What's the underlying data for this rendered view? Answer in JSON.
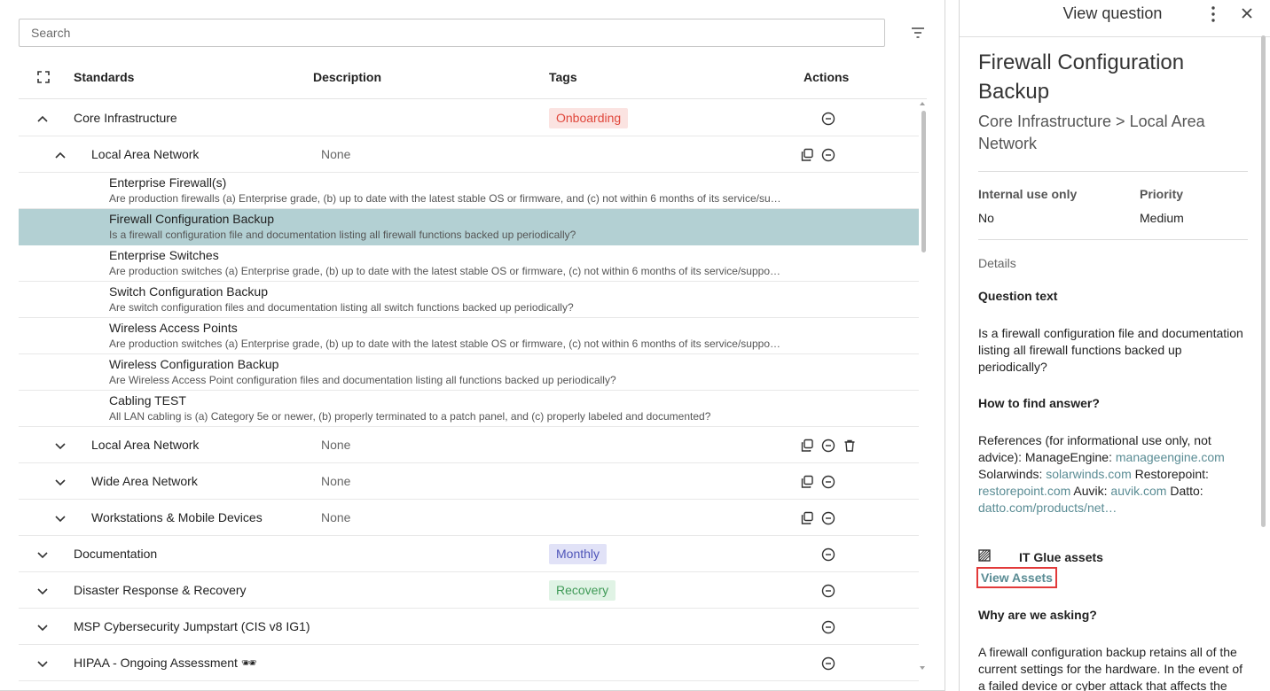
{
  "search": {
    "placeholder": "Search"
  },
  "table": {
    "headers": {
      "standards": "Standards",
      "description": "Description",
      "tags": "Tags",
      "actions": "Actions"
    },
    "groups": {
      "core": {
        "name": "Core Infrastructure",
        "tag": "Onboarding"
      },
      "lan1": {
        "name": "Local Area Network",
        "desc": "None"
      },
      "lan2": {
        "name": "Local Area Network",
        "desc": "None"
      },
      "wan": {
        "name": "Wide Area Network",
        "desc": "None"
      },
      "work": {
        "name": "Workstations & Mobile Devices",
        "desc": "None"
      },
      "doc": {
        "name": "Documentation",
        "tag": "Monthly"
      },
      "drr": {
        "name": "Disaster Response & Recovery",
        "tag": "Recovery"
      },
      "msp": {
        "name": "MSP Cybersecurity Jumpstart (CIS v8 IG1)"
      },
      "hipaa": {
        "name": "HIPAA - Ongoing Assessment 🕶"
      }
    },
    "questions": [
      {
        "title": "Enterprise Firewall(s)",
        "subtitle": "Are production firewalls (a) Enterprise grade, (b) up to date with the latest stable OS or firmware, and (c) not within 6 months of its service/support end-of-life date?"
      },
      {
        "title": "Firewall Configuration Backup",
        "subtitle": "Is a firewall configuration file and documentation listing all firewall functions backed up periodically?"
      },
      {
        "title": "Enterprise Switches",
        "subtitle": "Are production switches (a) Enterprise grade, (b) up to date with the latest stable OS or firmware, (c) not within 6 months of its service/support end-of-life date?"
      },
      {
        "title": "Switch Configuration Backup",
        "subtitle": "Are switch configuration files and documentation listing all switch functions backed up periodically?"
      },
      {
        "title": "Wireless Access Points",
        "subtitle": "Are production switches (a) Enterprise grade, (b) up to date with the latest stable OS or firmware, (c) not within 6 months of its service/support end-of-life date?"
      },
      {
        "title": "Wireless Configuration Backup",
        "subtitle": "Are Wireless Access Point configuration files and documentation listing all functions backed up periodically?"
      },
      {
        "title": "Cabling TEST",
        "subtitle": "All LAN cabling is (a) Category 5e or newer, (b) properly terminated to a patch panel, and (c) properly labeled and documented?"
      }
    ]
  },
  "detail": {
    "header_title": "View question",
    "title": "Firewall Configuration Backup",
    "path": "Core Infrastructure > Local Area Network",
    "internal_label": "Internal use only",
    "internal_value": "No",
    "priority_label": "Priority",
    "priority_value": "Medium",
    "details_label": "Details",
    "question_text_label": "Question text",
    "question_text": "Is a firewall configuration file and documentation listing all firewall functions backed up periodically?",
    "how_label": "How to find answer?",
    "references": {
      "t1": "References (for informational use only, not advice): ManageEngine: ",
      "l1": "manageengine.com",
      "t2": " Solarwinds: ",
      "l2": "solarwinds.com",
      "t3": " Restorepoint: ",
      "l3": "restorepoint.com",
      "t4": " Auvik: ",
      "l4": "auvik.com",
      "t5": " Datto: ",
      "l5": "datto.com/products/net…"
    },
    "assets_label": "IT Glue assets",
    "view_assets": "View Assets",
    "why_label": "Why are we asking?",
    "why_text": "A firewall configuration backup retains all of the current settings for the hardware. In the event of a failed device or cyber attack that affects the"
  },
  "colors": {
    "selected_row": "#b3d0d3",
    "onboarding_bg": "#fbe3e1",
    "onboarding_fg": "#e0483d",
    "monthly_bg": "#e1e2f7",
    "monthly_fg": "#4f55b9",
    "recovery_bg": "#e0f3e5",
    "recovery_fg": "#3f9a57",
    "link": "#5a8c94",
    "highlight_border": "#e23a3a"
  },
  "icons": [
    "filter-icon",
    "expand-all-icon",
    "chevron-up-icon",
    "chevron-down-icon",
    "copy-icon",
    "remove-circle-icon",
    "trash-icon",
    "kebab-menu-icon",
    "close-icon",
    "assets-icon"
  ]
}
